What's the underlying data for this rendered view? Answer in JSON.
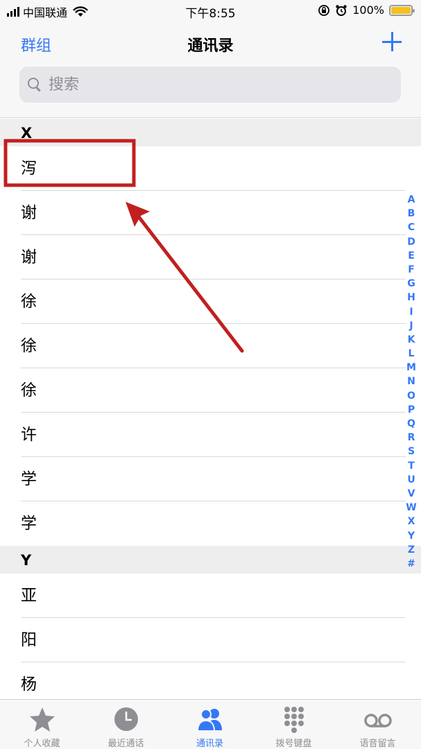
{
  "status_bar": {
    "carrier": "中国联通",
    "time": "下午8:55",
    "battery_percent": "100%"
  },
  "nav": {
    "left_label": "群组",
    "title": "通讯录",
    "add_icon": "plus-icon"
  },
  "search": {
    "placeholder": "搜索"
  },
  "sections": {
    "x": {
      "letter": "X",
      "contacts": [
        "泻",
        "谢",
        "谢",
        "徐",
        "徐",
        "徐",
        "许",
        "学",
        "学"
      ]
    },
    "y": {
      "letter": "Y",
      "contacts": [
        "亚",
        "阳",
        "杨"
      ]
    }
  },
  "index_letters": [
    "A",
    "B",
    "C",
    "D",
    "E",
    "F",
    "G",
    "H",
    "I",
    "J",
    "K",
    "L",
    "M",
    "N",
    "O",
    "P",
    "Q",
    "R",
    "S",
    "T",
    "U",
    "V",
    "W",
    "X",
    "Y",
    "Z",
    "#"
  ],
  "tabs": [
    {
      "label": "个人收藏",
      "icon": "star-icon"
    },
    {
      "label": "最近通话",
      "icon": "clock-icon"
    },
    {
      "label": "通讯录",
      "icon": "contacts-icon"
    },
    {
      "label": "拨号键盘",
      "icon": "keypad-icon"
    },
    {
      "label": "语音留言",
      "icon": "voicemail-icon"
    }
  ],
  "colors": {
    "accent": "#3478f6",
    "annotation": "#c0201f",
    "battery": "#f3c121"
  }
}
